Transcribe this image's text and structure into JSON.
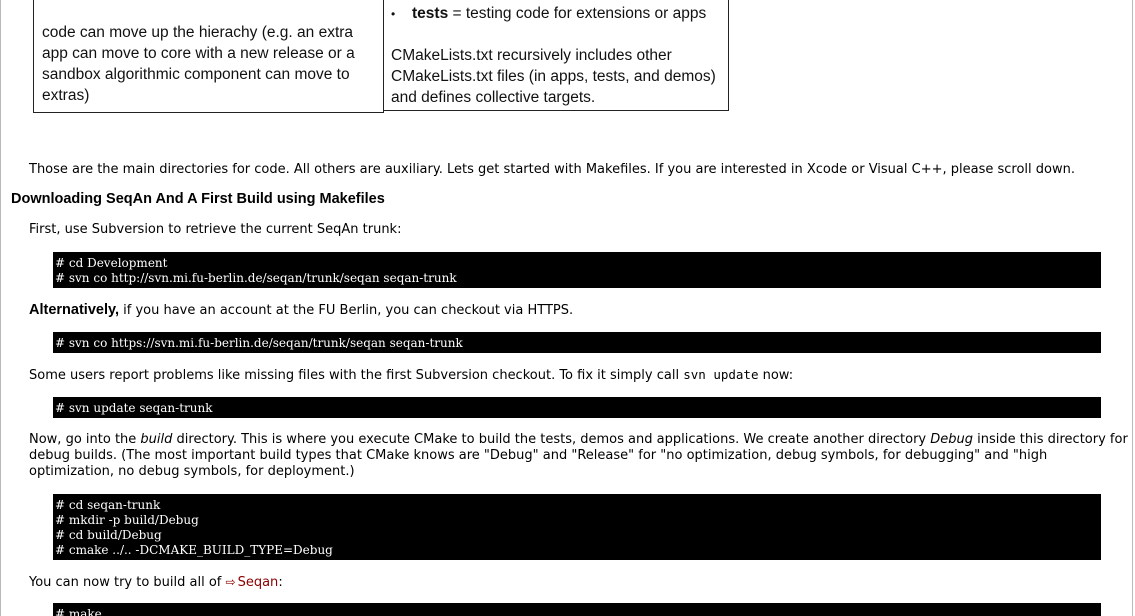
{
  "table": {
    "left_cell_lines": [
      "code can move up the hierachy (e.g. an extra",
      "app can move to core with a new release or a",
      "sandbox algorithmic component can move to",
      "extras)"
    ],
    "right_bullet_term": "tests",
    "right_bullet_rest": " = testing code for extensions or apps",
    "right_para_lines": [
      "CMakeLists.txt recursively includes other",
      "CMakeLists.txt files (in apps, tests, and demos)",
      "and defines collective targets."
    ]
  },
  "intro": "Those are the main directories for code. All others are auxiliary. Lets get started with Makefiles. If you are interested in Xcode or Visual C++, please scroll down.",
  "section_heading": "Downloading SeqAn And A First Build using Makefiles",
  "step1": "First, use Subversion to retrieve the current SeqAn trunk:",
  "code1": "# cd Development\n# svn co http://svn.mi.fu-berlin.de/seqan/trunk/seqan seqan-trunk",
  "alt_strong": "Alternatively,",
  "alt_rest": " if you have an account at the FU Berlin, you can checkout via HTTPS.",
  "code2": "# svn co https://svn.mi.fu-berlin.de/seqan/trunk/seqan seqan-trunk",
  "problem_before": "Some users report problems like missing files with the first Subversion checkout. To fix it simply call ",
  "problem_code": "svn update",
  "problem_after": " now:",
  "code3": "# svn update seqan-trunk",
  "build_p1": "Now, go into the ",
  "build_em1": "build",
  "build_p2": " directory. This is where you execute CMake to build the tests, demos and applications. We create another directory ",
  "build_em2": "Debug",
  "build_p3": " inside this directory for debug builds. (The most important build types that CMake knows are \"Debug\" and \"Release\" for \"no optimization, debug symbols, for debugging\" and \"high optimization, no debug symbols, for deployment.)",
  "code4": "# cd seqan-trunk\n# mkdir -p build/Debug\n# cd build/Debug\n# cmake ../.. -DCMAKE_BUILD_TYPE=Debug",
  "try_before": "You can now try to build all of ",
  "try_link": "Seqan",
  "try_after": ":",
  "code5": "# make"
}
